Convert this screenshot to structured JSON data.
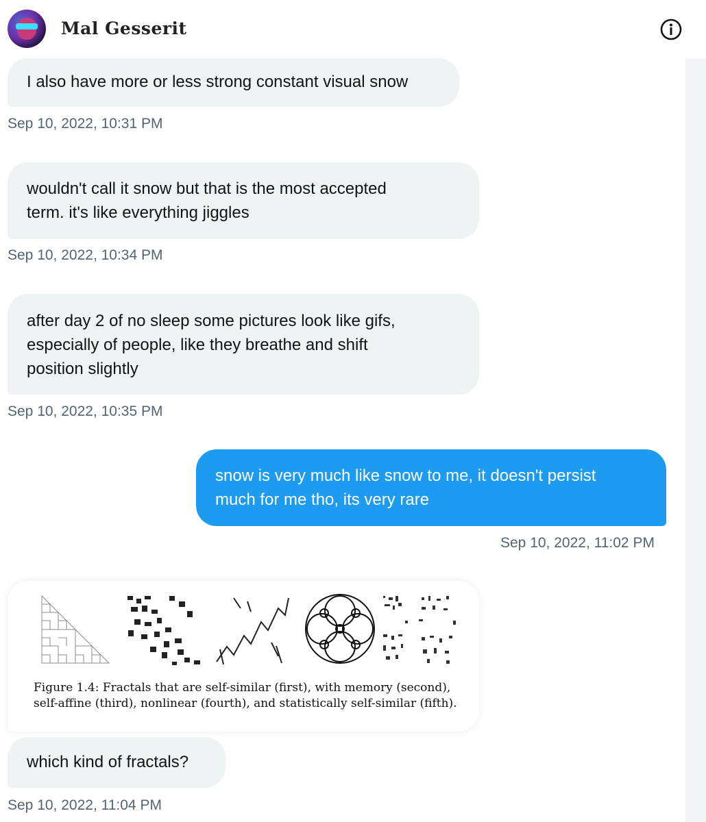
{
  "header": {
    "name": "Mal Gesserit",
    "avatar_icon": "avatar-icon",
    "info_icon": "info-icon"
  },
  "messages": [
    {
      "direction": "in",
      "text": "I also have more or less strong constant visual snow",
      "timestamp": "Sep 10, 2022, 10:31 PM"
    },
    {
      "direction": "in",
      "lines": [
        "wouldn't call it snow but that is the most accepted",
        "term. it's like everything jiggles"
      ],
      "timestamp": "Sep 10, 2022, 10:34 PM"
    },
    {
      "direction": "in",
      "lines": [
        "after day 2 of no sleep some pictures look like gifs,",
        "especially of people, like they breathe and shift",
        "position slightly"
      ],
      "timestamp": "Sep 10, 2022, 10:35 PM"
    },
    {
      "direction": "out",
      "lines": [
        "snow is very much like snow to me, it doesn't persist",
        "much for me tho, its very rare"
      ],
      "timestamp": "Sep 10, 2022, 11:02 PM"
    },
    {
      "direction": "in",
      "type": "image",
      "caption": "Figure 1.4: Fractals that are self-similar (first), with memory  (second),\nself-affine (third), nonlinear  (fourth), and statistically self-similar  (fifth)."
    },
    {
      "direction": "in",
      "text": "which kind of fractals?",
      "timestamp": "Sep 10, 2022, 11:04 PM"
    }
  ],
  "colors": {
    "incoming_bubble": "#eff3f4",
    "outgoing_bubble": "#1d9bf0",
    "timestamp": "#536471"
  }
}
